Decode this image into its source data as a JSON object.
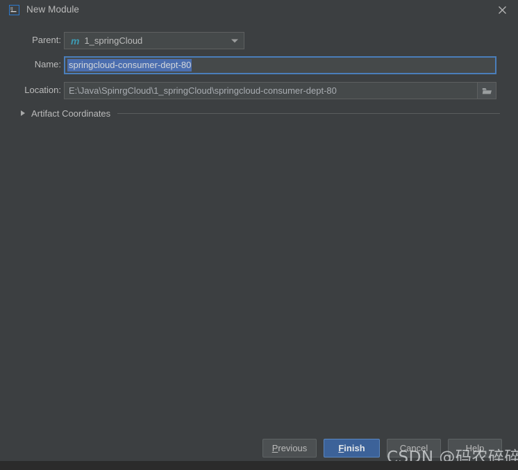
{
  "window": {
    "title": "New Module",
    "app_icon": "intellij-idea-logo-icon",
    "close_icon": "close-icon",
    "background_color": "#3c3f41",
    "accent_color": "#4a7ebb"
  },
  "form": {
    "parent": {
      "label": "Parent:",
      "icon": "maven-module-icon",
      "icon_glyph": "m",
      "value": "1_springCloud",
      "dropdown_icon": "chevron-down-icon"
    },
    "name": {
      "label": "Name:",
      "value": "springcloud-consumer-dept-80",
      "selected": true,
      "selection_color": "#4b6eaf"
    },
    "location": {
      "label": "Location:",
      "value": "E:\\Java\\SpinrgCloud\\1_springCloud\\springcloud-consumer-dept-80",
      "browse_icon": "folder-icon"
    }
  },
  "artifact_coordinates": {
    "label": "Artifact Coordinates",
    "expanded": false,
    "toggle_icon": "chevron-right-icon"
  },
  "footer": {
    "buttons": [
      {
        "name": "previous",
        "label": "Previous",
        "mnemonic": "P",
        "primary": false
      },
      {
        "name": "finish",
        "label": "Finish",
        "mnemonic": "F",
        "primary": true
      },
      {
        "name": "cancel",
        "label": "Cancel",
        "mnemonic": "",
        "primary": false
      },
      {
        "name": "help",
        "label": "Help",
        "mnemonic": "",
        "primary": false
      }
    ]
  },
  "watermark": {
    "text": "CSDN @码农碎碎念"
  }
}
